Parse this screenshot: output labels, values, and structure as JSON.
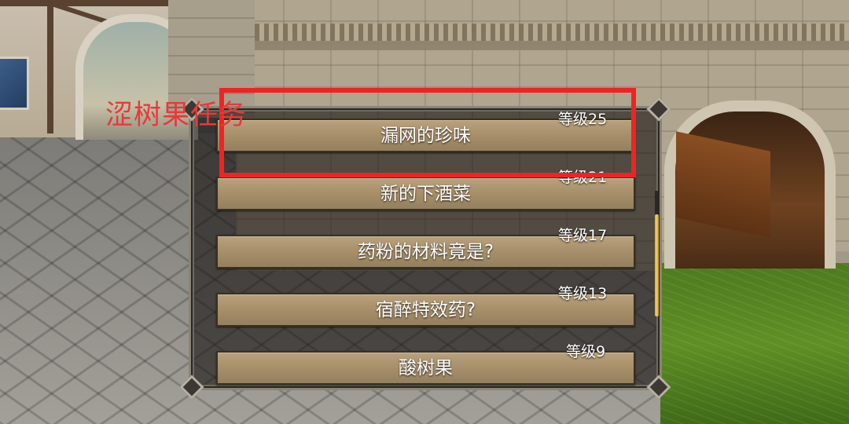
{
  "annotation": {
    "label": "涩树果任务",
    "color": "#ee2424"
  },
  "dialog": {
    "quests": [
      {
        "title": "漏网的珍味",
        "level": "等级25",
        "highlighted": true
      },
      {
        "title": "新的下酒菜",
        "level": "等级21",
        "highlighted": false
      },
      {
        "title": "药粉的材料竟是?",
        "level": "等级17",
        "highlighted": false
      },
      {
        "title": "宿醉特效药?",
        "level": "等级13",
        "highlighted": false
      },
      {
        "title": "酸树果",
        "level": "等级9",
        "highlighted": false
      }
    ],
    "scrollbar_color": "#e0b545",
    "button_color": "#a58d68"
  }
}
